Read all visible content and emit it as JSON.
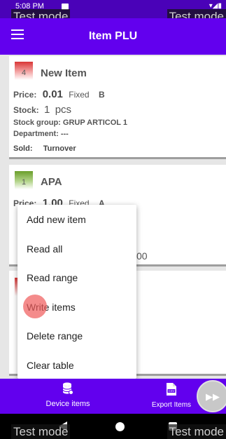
{
  "status_bar": {
    "time": "5:08 PM",
    "watermark": "Test mode"
  },
  "header": {
    "title": "Item PLU"
  },
  "labels": {
    "price": "Price:",
    "stock": "Stock:",
    "stock_group": "Stock group:",
    "department": "Department:",
    "sold": "Sold:",
    "turnover": "Turnover"
  },
  "items": [
    {
      "code": "4",
      "name": "New Item",
      "price": "0.01",
      "price_type": "Fixed",
      "vat": "B",
      "stock": "1",
      "unit": "pcs",
      "stock_group": "GRUP ARTICOL 1",
      "department": "---"
    },
    {
      "code": "1",
      "name": "APA",
      "price": "1.00",
      "price_type": "Fixed",
      "vat": "A",
      "partial_value": "00"
    }
  ],
  "popup_menu": {
    "items": [
      "Add new item",
      "Read all",
      "Read range",
      "Write items",
      "Delete range",
      "Clear table"
    ]
  },
  "bottom_nav": {
    "device_items": "Device items",
    "export_items": "Export Items",
    "fab_icon": "fast-forward-icon"
  },
  "colors": {
    "primary": "#6200ee",
    "status_bar": "#4a02b8",
    "badge_red": "#d93636",
    "badge_green": "#6a9e2a"
  }
}
